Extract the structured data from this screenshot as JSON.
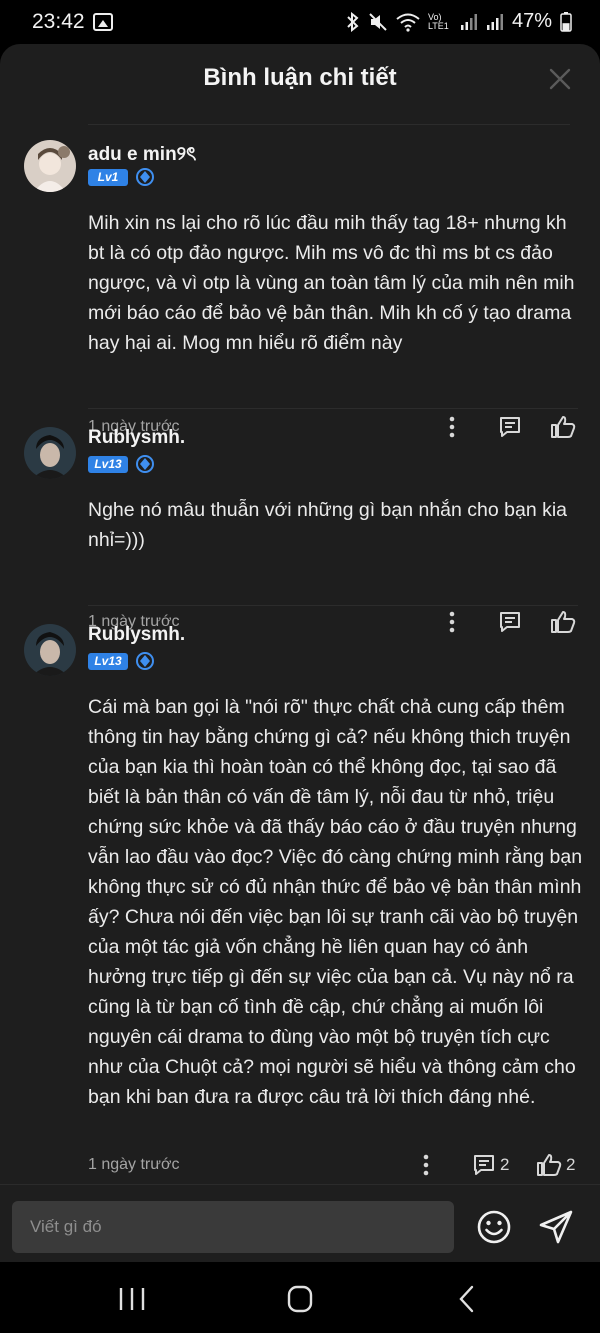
{
  "status_bar": {
    "time": "23:42",
    "network_label": "Vo) LTE1",
    "battery_percent": "47%",
    "battery_level": 0.47,
    "icons": [
      "gallery-icon",
      "bluetooth-icon",
      "mute-icon",
      "wifi-icon",
      "signal-icon",
      "battery-icon"
    ]
  },
  "header": {
    "title": "Bình luận chi tiết",
    "close_icon": "close-icon"
  },
  "comments": [
    {
      "user": "adu e min୨ৎ",
      "level": "Lv1",
      "text": "Mih xin ns lại cho rõ lúc đầu mih thấy tag 18+ nhưng kh bt là có otp đảo ngược. Mih ms vô đc thì ms bt cs đảo ngược, và vì otp là vùng an toàn tâm lý của mih nên mih mới báo cáo để bảo vệ bản thân. Mih kh cố ý tạo drama hay hại ai. Mog mn hiểu rõ điểm này",
      "time": "1 ngày trước",
      "reply_count": "",
      "like_count": ""
    },
    {
      "user": "Rublysmh.",
      "level": "Lv13",
      "text": "Nghe nó mâu thuẫn với những gì bạn nhắn cho bạn kia nhỉ=)))",
      "time": "1 ngày trước",
      "reply_count": "",
      "like_count": ""
    },
    {
      "user": "Rublysmh.",
      "level": "Lv13",
      "text": "Cái mà ban gọi là \"nói rõ\" thực chất chả cung cấp thêm thông tin hay bằng chứng gì cả? nếu không thich truyện của bạn kia thì hoàn toàn có thể không đọc, tại sao đã biết là bản thân có vấn đề tâm lý, nỗi đau từ nhỏ, triệu chứng sức khỏe và đã thấy báo cáo ở đầu truyện nhưng vẫn lao đầu vào đọc? Việc đó càng chứng minh rằng bạn không thực sử có đủ nhận thức để bảo vệ bản thân mình ấy? Chưa nói đến việc bạn lôi sự tranh cãi vào bộ truyện của một tác giả vốn chẳng hề liên quan hay có ảnh hưởng trực tiếp gì đến sự việc của bạn cả. Vụ này nổ ra cũng là từ bạn cố tình đề cập, chứ chẳng ai muốn lôi nguyên cái drama to đùng vào một bộ truyện tích cực như của Chuột cả? mọi người sẽ hiểu và thông cảm cho bạn khi ban đưa ra được câu trả lời thích đáng nhé.",
      "time": "1 ngày trước",
      "reply_count": "2",
      "like_count": "2"
    }
  ],
  "input": {
    "placeholder": "Viết gì đó"
  },
  "colors": {
    "sheet_bg": "#1e1e1e",
    "accent_blue": "#2f82e6",
    "muted_text": "#a4a4a4"
  }
}
